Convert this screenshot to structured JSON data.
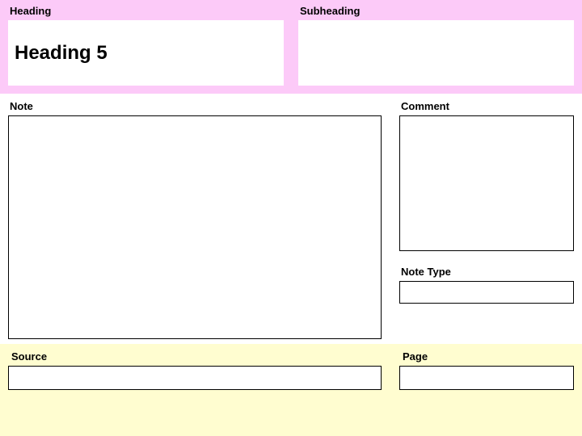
{
  "top": {
    "heading_label": "Heading",
    "heading_value": "Heading 5",
    "subheading_label": "Subheading",
    "subheading_value": ""
  },
  "mid": {
    "note_label": "Note",
    "note_value": "",
    "comment_label": "Comment",
    "comment_value": "",
    "notetype_label": "Note Type",
    "notetype_value": ""
  },
  "bottom": {
    "source_label": "Source",
    "source_value": "",
    "page_label": "Page",
    "page_value": ""
  }
}
